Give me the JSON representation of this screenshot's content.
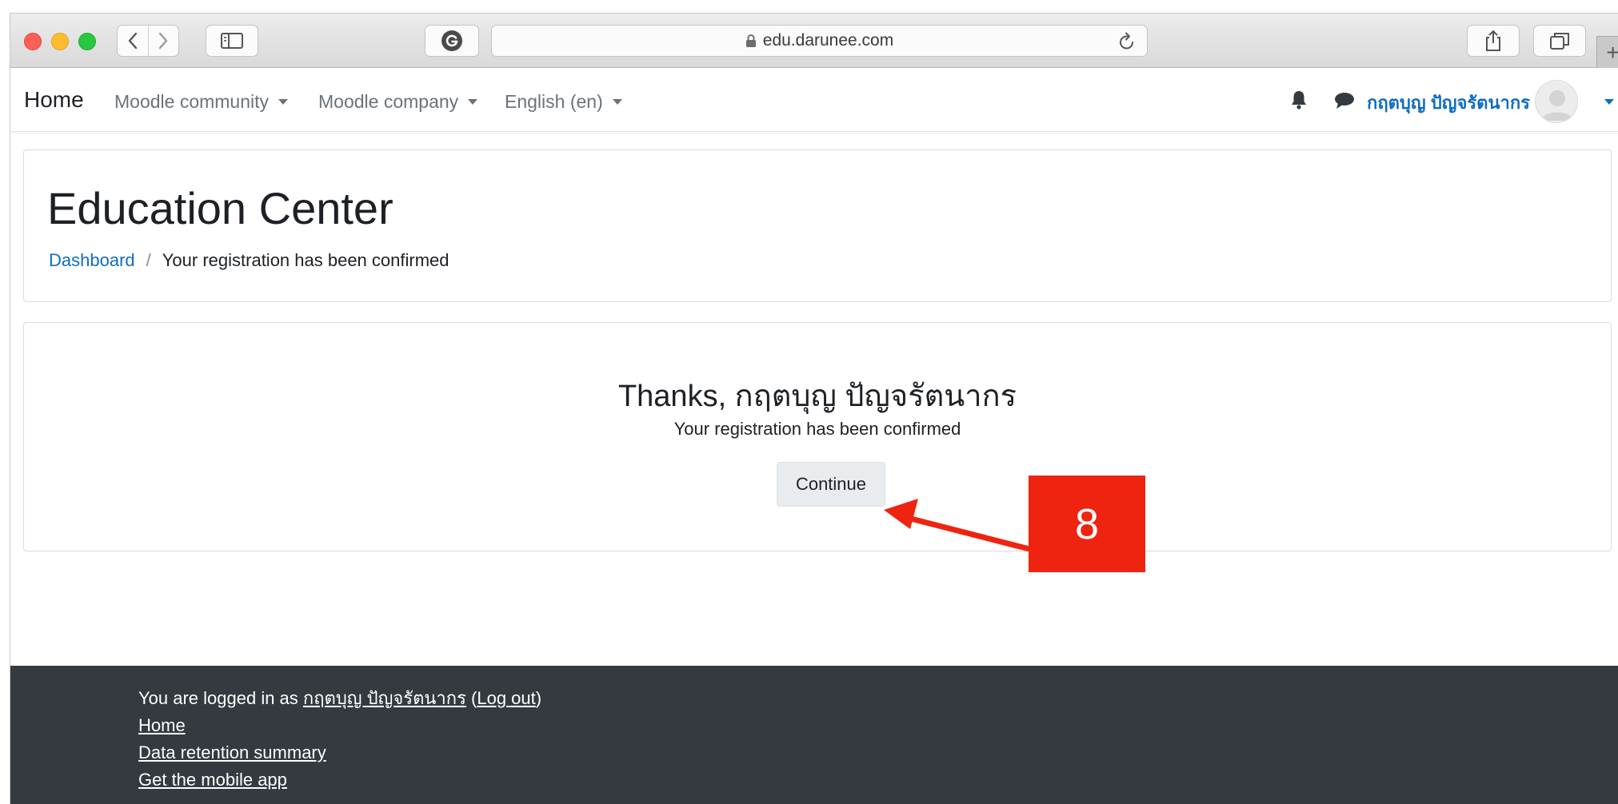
{
  "browser": {
    "url": "edu.darunee.com",
    "new_tab_glyph": "+"
  },
  "navbar": {
    "brand": "Home",
    "menus": [
      {
        "label": "Moodle community"
      },
      {
        "label": "Moodle company"
      },
      {
        "label": "English (en)"
      }
    ],
    "username": "กฤตบุญ ปัญจรัตนากร"
  },
  "header": {
    "title": "Education Center",
    "breadcrumb": {
      "dashboard": "Dashboard",
      "separator": "/",
      "current": "Your registration has been confirmed"
    }
  },
  "main": {
    "thanks": "Thanks, กฤตบุญ ปัญจรัตนากร",
    "message": "Your registration has been confirmed",
    "continue_label": "Continue"
  },
  "annotation": {
    "step_number": "8",
    "color": "#ee2411"
  },
  "footer": {
    "logged_in_prefix": "You are logged in as ",
    "user_link": "กฤตบุญ ปัญจรัตนากร",
    "open_paren": " (",
    "logout": "Log out",
    "close_paren": ")",
    "links": [
      "Home",
      "Data retention summary",
      "Get the mobile app"
    ]
  },
  "colors": {
    "link": "#0f6cbf",
    "footer_bg": "#343a40",
    "button_bg": "#e9ecef"
  }
}
